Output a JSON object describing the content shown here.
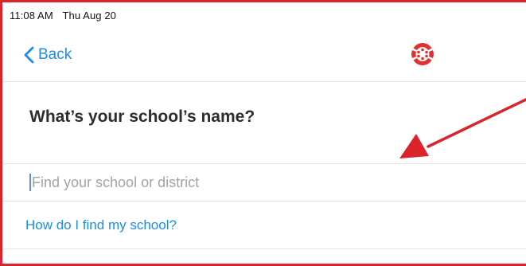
{
  "status_bar": {
    "time": "11:08 AM",
    "date": "Thu Aug 20"
  },
  "nav": {
    "back_label": "Back",
    "logo_icon": "canvas-logo-icon",
    "accent_color": "#1a8cf0",
    "logo_color": "#e0312e"
  },
  "main": {
    "title": "What’s your school’s name?",
    "search": {
      "placeholder": "Find your school or district",
      "value": ""
    },
    "help_link": "How do I find my school?"
  },
  "annotation": {
    "arrow_color": "#d9242b"
  }
}
